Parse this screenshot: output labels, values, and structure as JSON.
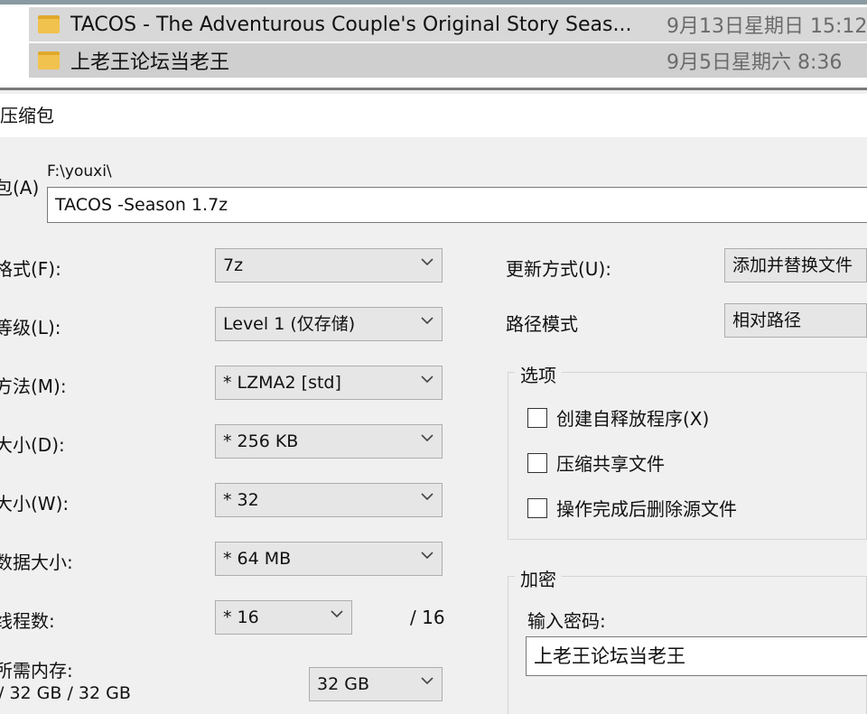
{
  "file_list": {
    "rows": [
      {
        "name": "TACOS - The Adventurous Couple's Original Story Seas...",
        "date": "9月13日星期日 15:12"
      },
      {
        "name": "上老王论坛当老王",
        "date": "9月5日星期六 8:36"
      }
    ]
  },
  "dialog": {
    "title": "压缩包",
    "archive_label": "包(A)",
    "archive_path": "F:\\youxi\\",
    "archive_name": "TACOS -Season 1.7z",
    "format_label": "格式(F):",
    "format_value": "7z",
    "level_label": "等级(L):",
    "level_value": "Level 1 (仅存储)",
    "method_label": "方法(M):",
    "method_value": "* LZMA2 [std]",
    "dict_label": "大小(D):",
    "dict_value": "* 256 KB",
    "word_label": "大小(W):",
    "word_value": "* 32",
    "solid_label": "数据大小:",
    "solid_value": "* 64 MB",
    "threads_label": "线程数:",
    "threads_value": "* 16",
    "threads_total": "/ 16",
    "memory_label": "所需内存:",
    "memory_value": "/ 32 GB / 32 GB",
    "memory_combo": "32 GB",
    "update_label": "更新方式(U):",
    "update_value": "添加并替换文件",
    "path_label": "路径模式",
    "path_value": "相对路径",
    "options_title": "选项",
    "options": [
      {
        "label": "创建自释放程序(X)",
        "checked": false
      },
      {
        "label": "压缩共享文件",
        "checked": false
      },
      {
        "label": "操作完成后删除源文件",
        "checked": false
      }
    ],
    "encrypt_title": "加密",
    "password_label": "输入密码:",
    "password_value": "上老王论坛当老王"
  },
  "icons": {
    "folder": "folder-icon",
    "chevron": "chevron-down-icon"
  },
  "colors": {
    "folder": "#f1c24e",
    "selected_row": "#d8d8d8"
  }
}
